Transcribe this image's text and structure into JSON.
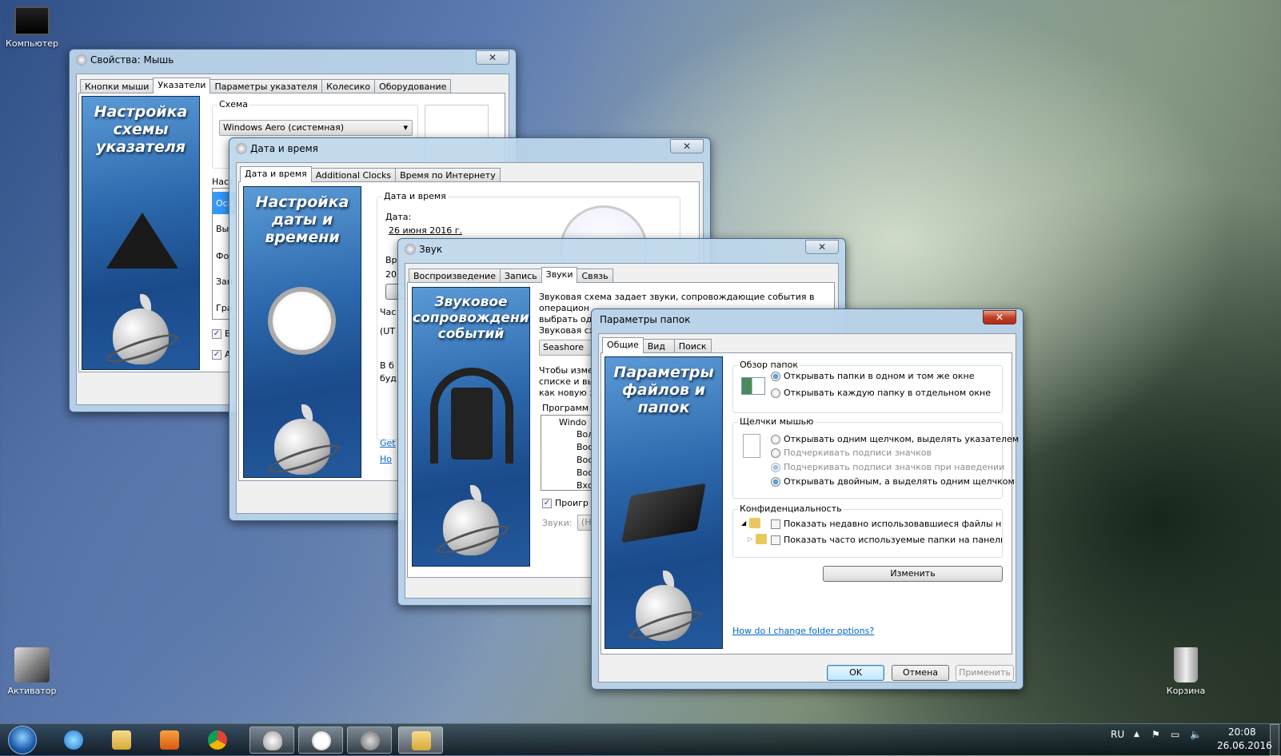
{
  "desktop": {
    "icons": [
      {
        "label": "Компьютер"
      },
      {
        "label": "Активатор"
      },
      {
        "label": "Корзина"
      }
    ]
  },
  "mouse_window": {
    "title": "Свойства: Мышь",
    "close": "✕",
    "tabs": [
      "Кнопки мыши",
      "Указатели",
      "Параметры указателя",
      "Колесико",
      "Оборудование"
    ],
    "selected_tab": 1,
    "banner_title": "Настройка схемы указателя",
    "scheme_label": "Схема",
    "scheme_value": "Windows Aero (системная)",
    "settings_label": "Наст",
    "list_items": [
      "Осн",
      "Вы",
      "Фо",
      "Зан",
      "Гра"
    ],
    "checkboxes": [
      {
        "label": "В",
        "checked": true
      },
      {
        "label": "А",
        "checked": true
      }
    ]
  },
  "date_window": {
    "title": "Дата и время",
    "close": "✕",
    "tabs": [
      "Дата и время",
      "Additional Clocks",
      "Время по Интернету"
    ],
    "selected_tab": 0,
    "banner_title": "Настройка даты и времени",
    "group_label": "Дата и время",
    "date_label": "Дата:",
    "date_value": "26 июня 2016 г.",
    "time_label": "Вр",
    "time_value": "20",
    "tz_group": "Час",
    "tz_value": "(UT",
    "dst_line1": "В б",
    "dst_line2": "буд",
    "links": [
      "Get",
      "Ho"
    ]
  },
  "sound_window": {
    "title": "Звук",
    "close": "✕",
    "tabs": [
      "Воспроизведение",
      "Запись",
      "Звуки",
      "Связь"
    ],
    "selected_tab": 2,
    "banner_title": "Звуковое сопровождение событий",
    "desc_lines": [
      "Звуковая схема задает звуки, сопровождающие события в",
      "операцион",
      "выбрать од"
    ],
    "scheme_label": "Звуковая сх",
    "scheme_value": "Seashore",
    "change_lines": [
      "Чтобы изме",
      "списке и вы",
      "как новую з"
    ],
    "programs_label": "Программ",
    "events": [
      "Windo",
      "Вол",
      "Вос",
      "Вос",
      "Вос",
      "Вхо"
    ],
    "play_checkbox": {
      "label": "Проигр",
      "checked": true
    },
    "sounds_label": "Звуки:",
    "sounds_value": "(Н"
  },
  "folder_window": {
    "title": "Параметры папок",
    "close": "✕",
    "tabs": [
      "Общие",
      "Вид",
      "Поиск"
    ],
    "selected_tab": 0,
    "banner_title": "Параметры файлов и папок",
    "browse": {
      "label": "Обзор папок",
      "options": [
        {
          "label": "Открывать папки в одном и том же окне",
          "checked": true,
          "enabled": true
        },
        {
          "label": "Открывать каждую папку в отдельном окне",
          "checked": false,
          "enabled": true
        }
      ]
    },
    "clicks": {
      "label": "Щелчки мышью",
      "options": [
        {
          "label": "Открывать одним щелчком, выделять указателем",
          "checked": false,
          "enabled": true
        },
        {
          "label": "Подчеркивать подписи значков",
          "checked": false,
          "enabled": false
        },
        {
          "label": "Подчеркивать подписи значков при наведении",
          "checked": true,
          "enabled": false
        },
        {
          "label": "Открывать двойным, а выделять одним щелчком",
          "checked": true,
          "enabled": true
        }
      ]
    },
    "privacy": {
      "label": "Конфиденциальность",
      "options": [
        {
          "label": "Показать недавно использовавшиеся файлы на пане",
          "checked": false
        },
        {
          "label": "Показать часто используемые папки на панели быс",
          "checked": false
        }
      ]
    },
    "change_button": "Изменить",
    "help_link": "How do I change folder options?",
    "ok": "OK",
    "cancel": "Отмена",
    "apply": "Применить"
  },
  "taskbar": {
    "language": "RU",
    "time": "20:08",
    "date": "26.06.2016"
  },
  "colors": {
    "accent": "#2c68ac",
    "link": "#0066cc",
    "close_red": "#c0402a"
  }
}
